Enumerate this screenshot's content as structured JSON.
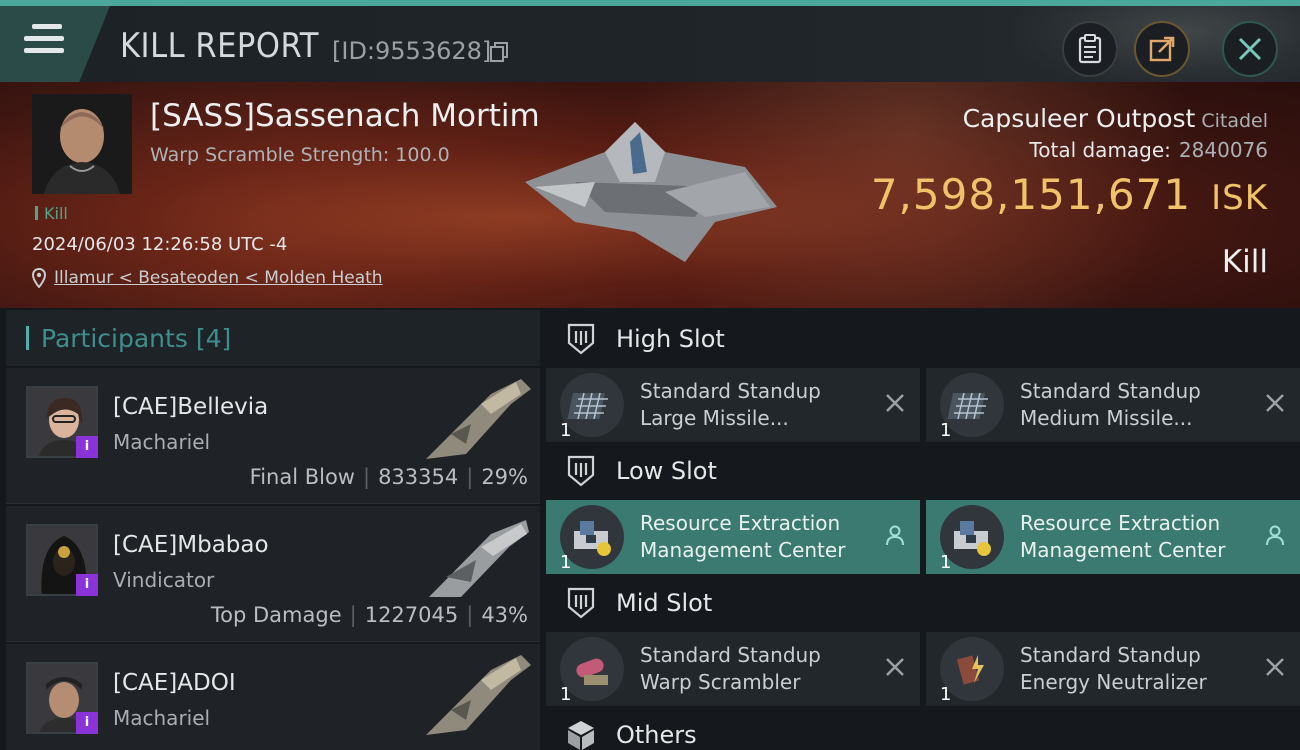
{
  "header": {
    "title": "KILL REPORT",
    "report_id": "[ID:9553628]"
  },
  "victim": {
    "name": "[SASS]Sassenach Mortim",
    "sub": "Warp Scramble Strength: 100.0",
    "kill_tag": "Kill",
    "datetime": "2024/06/03 12:26:58 UTC -4",
    "location": "Illamur < Besateoden < Molden Heath"
  },
  "target": {
    "name": "Capsuleer Outpost",
    "type": "Citadel",
    "total_damage_label": "Total damage:",
    "total_damage": "2840076",
    "isk_value": "7,598,151,671",
    "isk_unit": "ISK",
    "result": "Kill"
  },
  "participants": {
    "label": "Participants",
    "count": "[4]",
    "items": [
      {
        "name": "[CAE]Bellevia",
        "ship": "Machariel",
        "role": "Final Blow",
        "damage": "833354",
        "percent": "29%",
        "badge": "i"
      },
      {
        "name": "[CAE]Mbabao",
        "ship": "Vindicator",
        "role": "Top Damage",
        "damage": "1227045",
        "percent": "43%",
        "badge": "i"
      },
      {
        "name": "[CAE]ADOI",
        "ship": "Machariel",
        "badge": "i"
      }
    ]
  },
  "slots": {
    "high": {
      "label": "High Slot",
      "modules": [
        {
          "line1": "Standard Standup",
          "line2": "Large Missile...",
          "qty": "1"
        },
        {
          "line1": "Standard Standup",
          "line2": "Medium Missile...",
          "qty": "1"
        }
      ]
    },
    "low": {
      "label": "Low Slot",
      "modules": [
        {
          "line1": "Resource Extraction",
          "line2": "Management Center",
          "qty": "1"
        },
        {
          "line1": "Resource Extraction",
          "line2": "Management Center",
          "qty": "1"
        }
      ]
    },
    "mid": {
      "label": "Mid Slot",
      "modules": [
        {
          "line1": "Standard Standup",
          "line2": "Warp Scrambler",
          "qty": "1"
        },
        {
          "line1": "Standard Standup",
          "line2": "Energy Neutralizer",
          "qty": "1"
        }
      ]
    },
    "others": {
      "label": "Others"
    }
  },
  "colors": {
    "accent": "#4aa79a",
    "isk": "#f0c36a",
    "badge": "#8a33d8",
    "active_module": "#3a7a71"
  }
}
